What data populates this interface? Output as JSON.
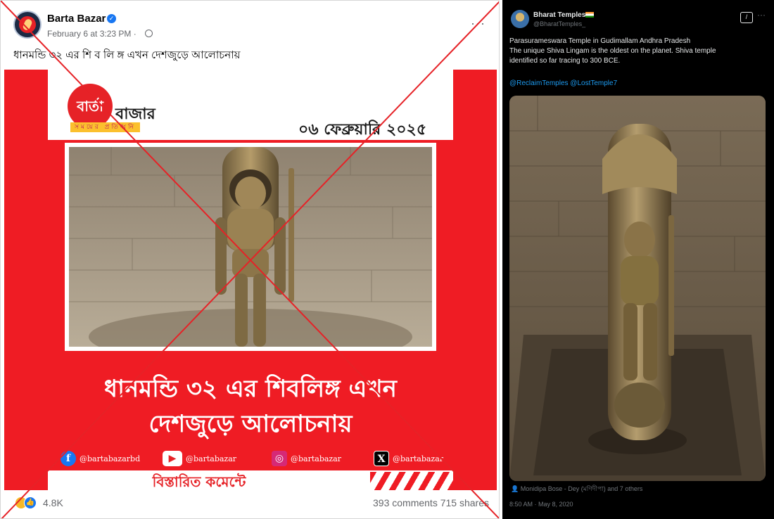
{
  "facebook": {
    "page_name": "Barta Bazar",
    "timestamp": "February 6 at 3:23 PM ·",
    "caption": "ধানমন্ডি ৩২ এর শি ব লি ঙ্গ এখন দেশজুড়ে আলোচনায়",
    "image": {
      "logo_mark": "বার্তা",
      "logo_word": "বাজার",
      "logo_tagline": "সময়ের প্রতিধ্বনি",
      "date": "০৬ ফেব্রুয়ারি ২০২৫",
      "headline_line1": "ধানমন্ডি ৩২ এর শিবলিঙ্গ এখন",
      "headline_line2": "দেশজুড়ে আলোচনায়",
      "socials": [
        {
          "icon": "facebook-icon",
          "glyph": "f",
          "handle": "@bartabazarbd"
        },
        {
          "icon": "youtube-icon",
          "glyph": "▶",
          "handle": "@bartabazar"
        },
        {
          "icon": "instagram-icon",
          "glyph": "◎",
          "handle": "@bartabazar"
        },
        {
          "icon": "x-icon",
          "glyph": "X",
          "handle": "@bartabazar"
        }
      ],
      "comment_cta": "বিস্তারিত কমেন্টে"
    },
    "reaction_count": "4.8K",
    "comments": "393 comments",
    "shares": "715 shares"
  },
  "twitter": {
    "display_name": "Bharat Temples",
    "handle": "@BharatTemples_",
    "text_line1": "Parasurameswara Temple in Gudimallam Andhra Pradesh",
    "text_line2": "The unique Shiva Lingam is the oldest on the planet. Shiva temple",
    "text_line3": "identified so far tracing to 300 BCE.",
    "mention1": "@ReclaimTemples",
    "mention2": "@LostTemple7",
    "tagged": "Monidipa Bose - Dey (মণিদীপা) and 7 others",
    "timestamp": "8:50 AM · May 8, 2020"
  },
  "colors": {
    "brand_red": "#ef1c24",
    "fb_blue": "#1877f2",
    "x_link": "#1d9bf0",
    "cross_mark": "#e62227"
  }
}
